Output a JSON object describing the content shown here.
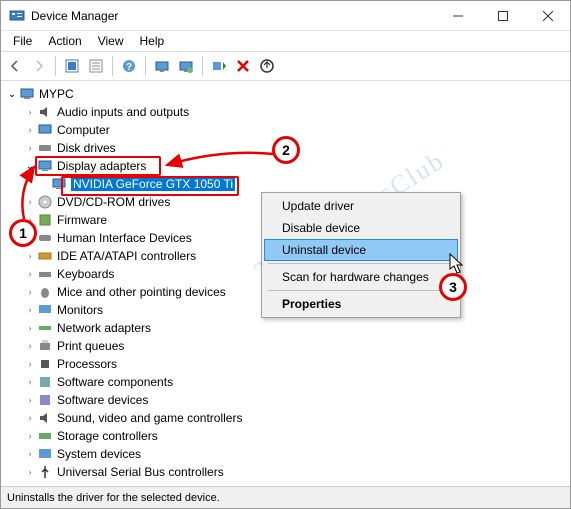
{
  "window": {
    "title": "Device Manager"
  },
  "menu": {
    "file": "File",
    "action": "Action",
    "view": "View",
    "help": "Help"
  },
  "tree": {
    "root": "MYPC",
    "items": [
      "Audio inputs and outputs",
      "Computer",
      "Disk drives",
      "Display adapters",
      "DVD/CD-ROM drives",
      "Firmware",
      "Human Interface Devices",
      "IDE ATA/ATAPI controllers",
      "Keyboards",
      "Mice and other pointing devices",
      "Monitors",
      "Network adapters",
      "Print queues",
      "Processors",
      "Software components",
      "Software devices",
      "Sound, video and game controllers",
      "Storage controllers",
      "System devices",
      "Universal Serial Bus controllers"
    ],
    "display_child": "NVIDIA GeForce GTX 1050 Ti"
  },
  "context_menu": {
    "update": "Update driver",
    "disable": "Disable device",
    "uninstall": "Uninstall device",
    "scan": "Scan for hardware changes",
    "properties": "Properties"
  },
  "statusbar": {
    "text": "Uninstalls the driver for the selected device."
  },
  "annotations": {
    "one": "1",
    "two": "2",
    "three": "3"
  },
  "watermark": "TheWindowsClub"
}
